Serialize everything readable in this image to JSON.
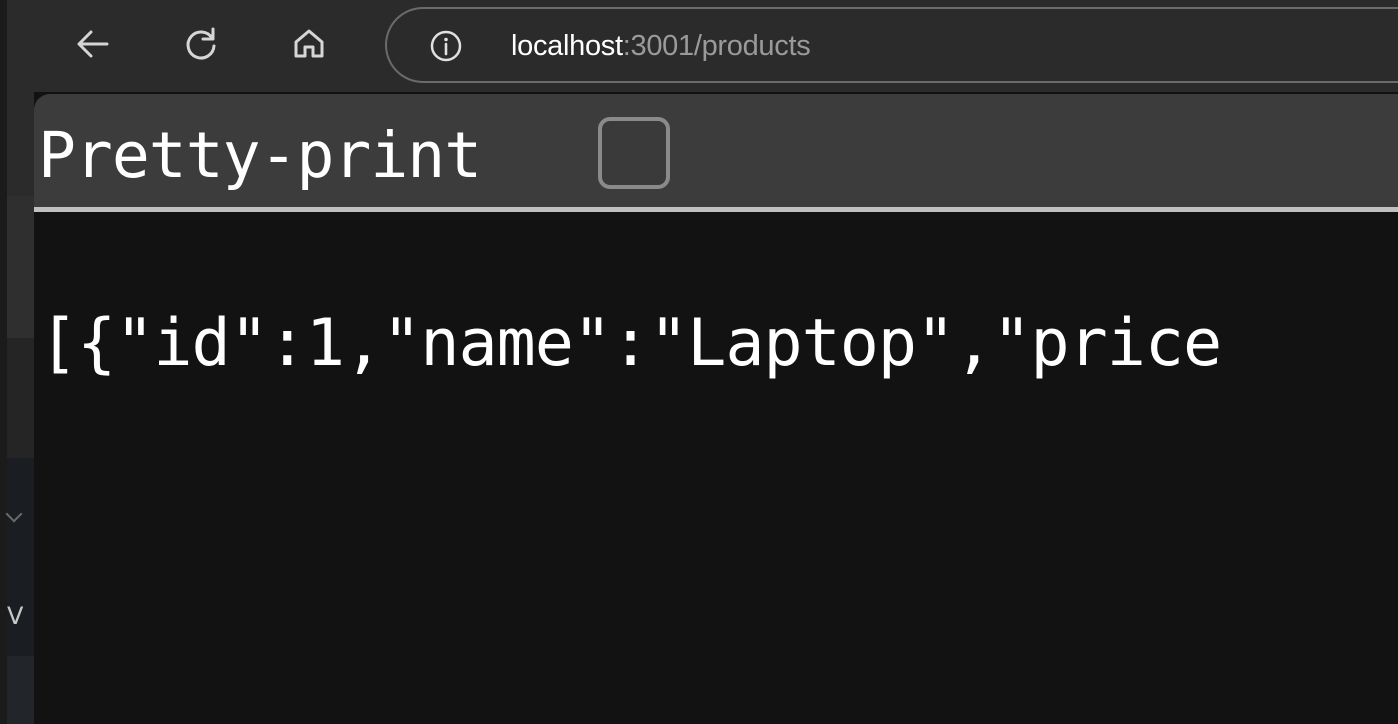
{
  "browser": {
    "url_host": "localhost",
    "url_rest": ":3001/products",
    "icons": {
      "back": "arrow-left-icon",
      "reload": "reload-icon",
      "home": "home-icon",
      "site_info": "info-icon"
    }
  },
  "viewer": {
    "pretty_print_label": "Pretty-print",
    "pretty_print_checked": false,
    "json_text": "[{\"id\":1,\"name\":\"Laptop\",\"price"
  },
  "side_window": {
    "glyph": "V"
  },
  "colors": {
    "toolbar_bg": "#2b2b2b",
    "page_bg": "#121212",
    "pretty_bar_bg": "#3c3c3c",
    "text": "#ffffff",
    "url_dim": "#9a9a9a"
  }
}
